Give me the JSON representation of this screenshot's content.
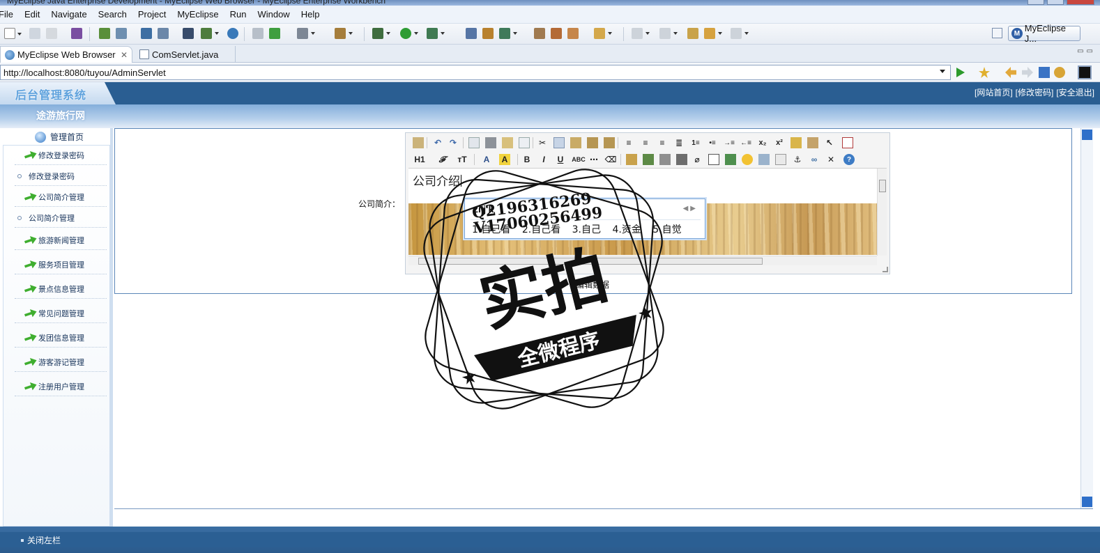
{
  "window": {
    "title": "MyEclipse Java Enterprise Development - MyEclipse Web Browser - MyEclipse Enterprise Workbench"
  },
  "menu": [
    "File",
    "Edit",
    "Navigate",
    "Search",
    "Project",
    "MyEclipse",
    "Run",
    "Window",
    "Help"
  ],
  "perspective": {
    "label": "MyEclipse J..."
  },
  "tabs": [
    {
      "label": "MyEclipse Web Browser",
      "close": "✕"
    },
    {
      "label": "ComServlet.java"
    }
  ],
  "browser": {
    "url": "http://localhost:8080/tuyou/AdminServlet"
  },
  "app": {
    "logo": "后台管理系统",
    "site_name": "途游旅行网",
    "top_links": [
      "[网站首页]",
      "[修改密码]",
      "[安全退出]"
    ],
    "home_link": "管理首页",
    "nav": [
      {
        "label": "修改登录密码",
        "type": "group"
      },
      {
        "label": "修改登录密码",
        "type": "sub"
      },
      {
        "label": "公司简介管理",
        "type": "group"
      },
      {
        "label": "公司简介管理",
        "type": "sub"
      },
      {
        "label": "旅游新闻管理",
        "type": "group"
      },
      {
        "label": "服务项目管理",
        "type": "group"
      },
      {
        "label": "景点信息管理",
        "type": "group"
      },
      {
        "label": "常见问题管理",
        "type": "group"
      },
      {
        "label": "发团信息管理",
        "type": "group"
      },
      {
        "label": "游客游记管理",
        "type": "group"
      },
      {
        "label": "注册用户管理",
        "type": "group"
      }
    ],
    "footer_link": "关闭左栏"
  },
  "form": {
    "field_label": "公司简介：",
    "editor_text": "公司介绍",
    "save_label": "编辑数据"
  },
  "editor_toolbar": {
    "row1": [
      "paste-icon",
      "undo-icon",
      "redo-icon",
      "preview-icon",
      "print-icon",
      "template-icon",
      "source-icon",
      "cut-icon",
      "copy-icon",
      "paste-text-icon",
      "paste-word-icon",
      "paste-html-icon",
      "align-left-icon",
      "align-center-icon",
      "align-right-icon",
      "align-justify-icon",
      "ordered-list-icon",
      "unordered-list-icon",
      "indent-icon",
      "outdent-icon",
      "subscript-icon",
      "superscript-icon",
      "clear-format-icon",
      "select-all-icon",
      "cursor-icon",
      "fullscreen-icon"
    ],
    "row2_text": {
      "heading": "H1",
      "fontfamily": "𝓕",
      "fontsize": "ᴛT",
      "bold": "B",
      "italic": "I",
      "underline": "U",
      "strike": "ABC"
    }
  },
  "ime": {
    "input": "zi'j'k",
    "arrows": "◀▶",
    "candidates": [
      "1.自己看",
      "2.自己看",
      "3.自己",
      "4.资金",
      "5.自觉"
    ]
  },
  "watermark": {
    "main": "实拍",
    "banner": "全微程序",
    "codes": [
      "Q2196316269",
      "V17060256499"
    ]
  }
}
